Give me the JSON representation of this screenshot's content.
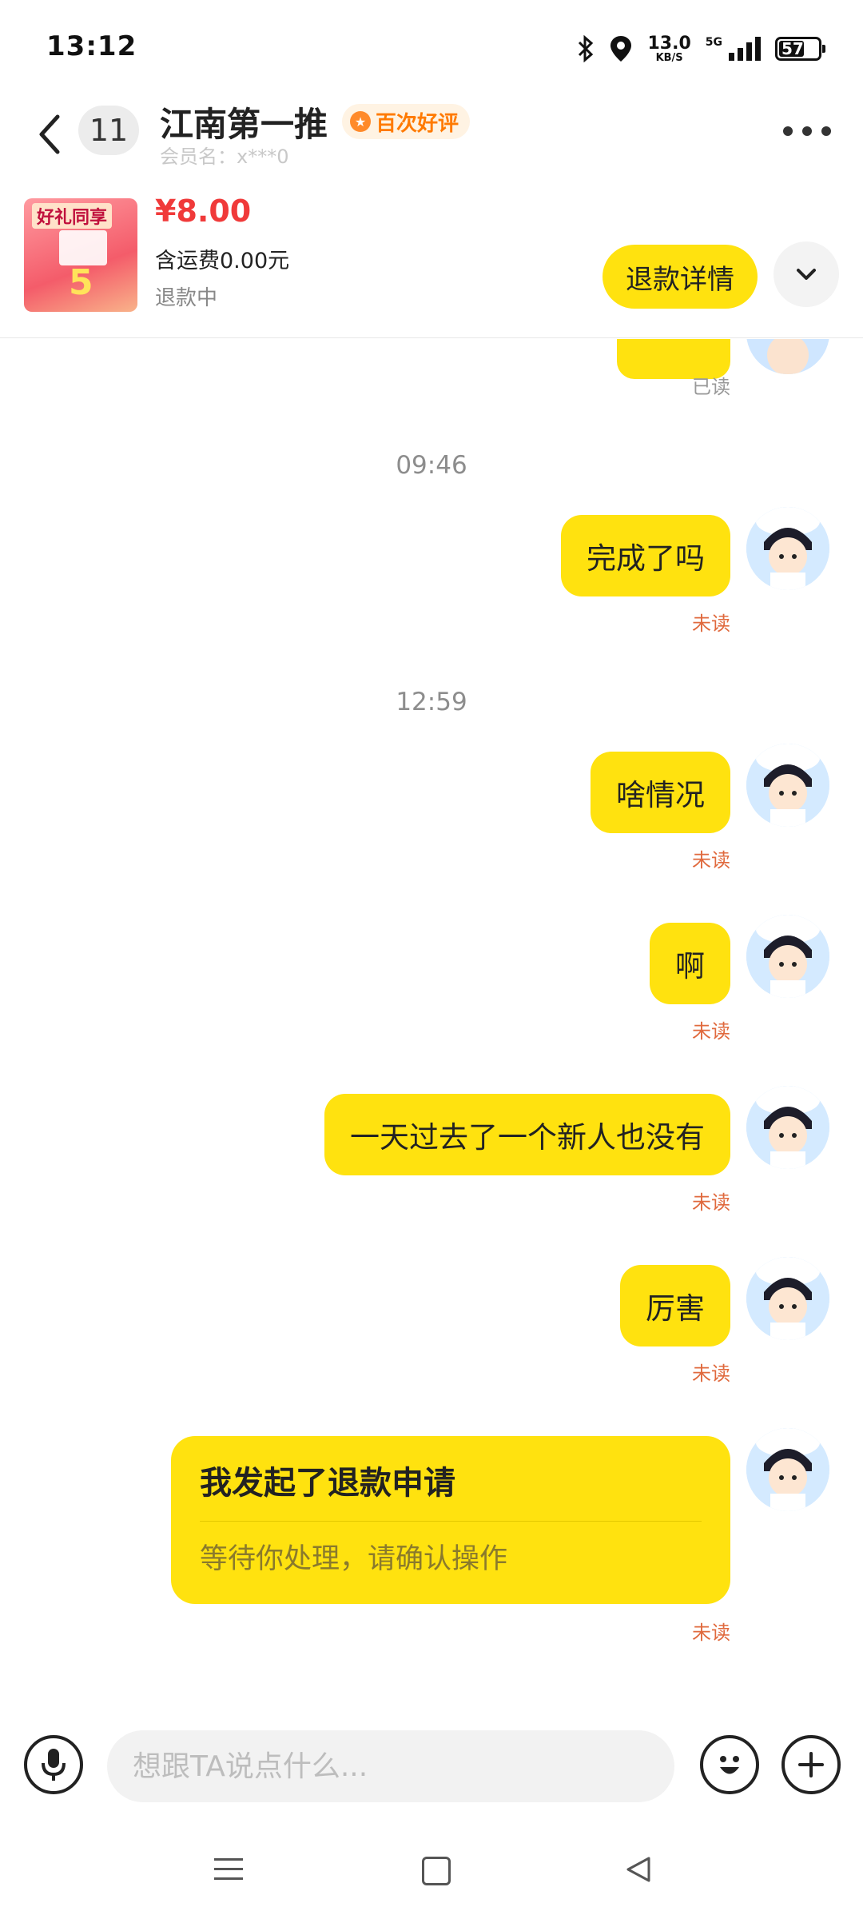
{
  "status_bar": {
    "time": "13:12",
    "net_speed": "13.0",
    "net_unit": "KB/S",
    "network_type": "5G",
    "battery": "57",
    "icons": [
      "bluetooth-icon",
      "location-icon",
      "signal-icon",
      "battery-icon"
    ]
  },
  "header": {
    "unread_count": "11",
    "shop_name": "江南第一推",
    "tag": "百次好评",
    "member_label": "会员名：x***0"
  },
  "product": {
    "thumb_title": "好礼同享",
    "thumb_number": "5",
    "price": "¥8.00",
    "shipping": "含运费0.00元",
    "status": "退款中",
    "refund_button": "退款详情"
  },
  "chat": {
    "top_read_status": "已读",
    "timestamps": [
      "09:46",
      "12:59"
    ],
    "messages": [
      {
        "text": "完成了吗",
        "status": "未读"
      },
      {
        "text": "啥情况",
        "status": "未读"
      },
      {
        "text": "啊",
        "status": "未读"
      },
      {
        "text": "一天过去了一个新人也没有",
        "status": "未读"
      },
      {
        "text": "厉害",
        "status": "未读"
      }
    ],
    "refund_card": {
      "title": "我发起了退款申请",
      "subtitle": "等待你处理，请确认操作",
      "status": "未读"
    }
  },
  "input": {
    "placeholder": "想跟TA说点什么..."
  },
  "colors": {
    "bubble": "#ffe20f",
    "price": "#f03a3a",
    "unread": "#e06a3e",
    "tag": "#ff7a00"
  }
}
